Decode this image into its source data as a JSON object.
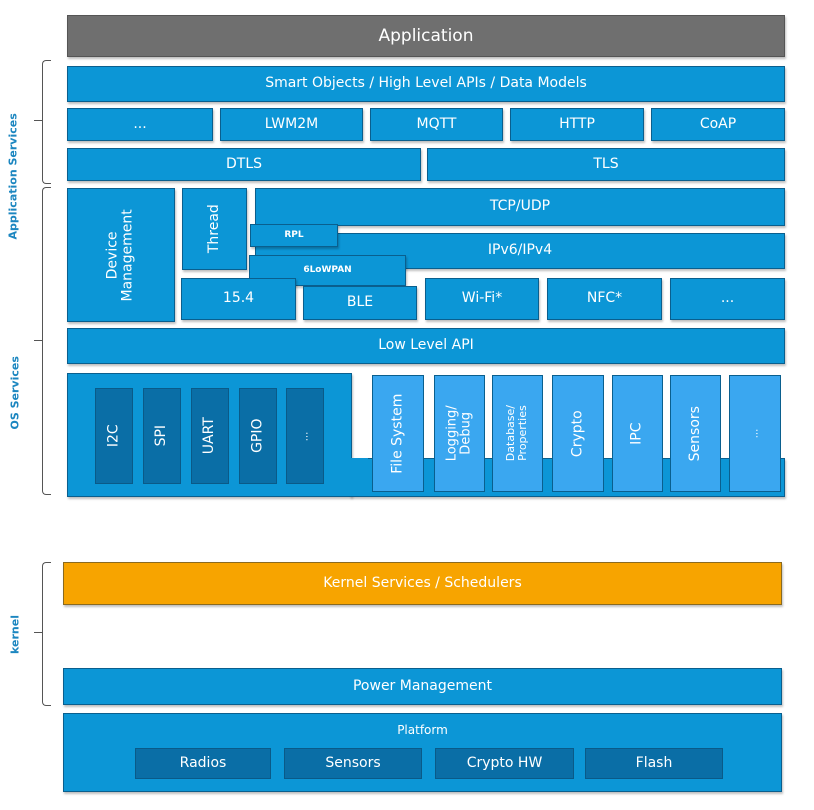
{
  "colors": {
    "blue": "#0c96d6",
    "dark_blue": "#0a6ea6",
    "light_blue": "#3aa7f0",
    "orange": "#f7a400",
    "gray": "#6f6f6f"
  },
  "side_labels": {
    "app_services": "Application Services",
    "os_services": "OS Services",
    "kernel": "kernel"
  },
  "application": "Application",
  "smart_objects": "Smart Objects / High Level APIs / Data Models",
  "protocols": [
    "...",
    "LWM2M",
    "MQTT",
    "HTTP",
    "CoAP"
  ],
  "security": [
    "DTLS",
    "TLS"
  ],
  "device_management": "Device Management",
  "thread": "Thread",
  "tcp_udp": "TCP/UDP",
  "rpl": "RPL",
  "ip": "IPv6/IPv4",
  "sixlowpan": "6LoWPAN",
  "links": [
    "15.4",
    "BLE",
    "Wi-Fi*",
    "NFC*",
    "..."
  ],
  "low_level_api": "Low Level API",
  "drivers": [
    "I2C",
    "SPI",
    "UART",
    "GPIO",
    "..."
  ],
  "services": [
    "File System",
    "Logging/ Debug",
    "Database/ Properties",
    "Crypto",
    "IPC",
    "Sensors",
    "..."
  ],
  "kernel_services": "Kernel Services / Schedulers",
  "power_management": "Power Management",
  "platform": {
    "title": "Platform",
    "items": [
      "Radios",
      "Sensors",
      "Crypto HW",
      "Flash"
    ]
  }
}
